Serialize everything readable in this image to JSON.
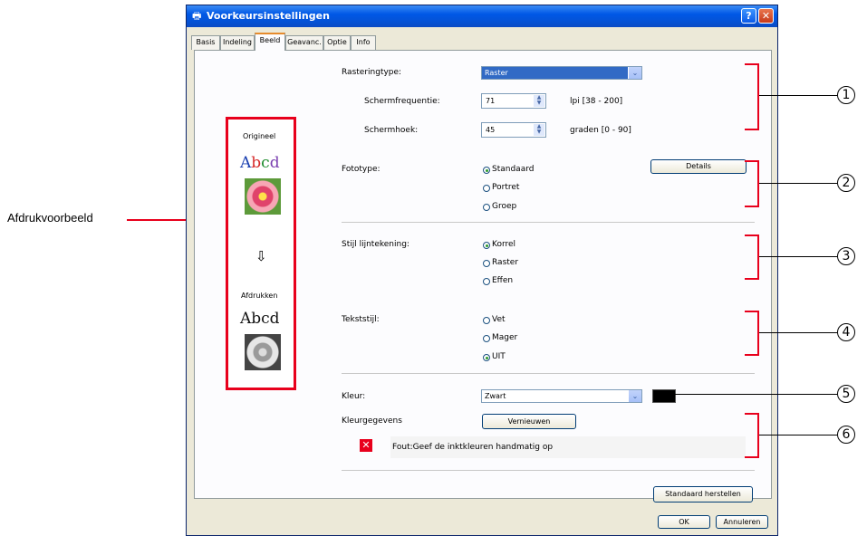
{
  "window": {
    "title": "Voorkeursinstellingen",
    "help_label": "?",
    "close_label": "✕"
  },
  "tabs": [
    {
      "label": "Basis"
    },
    {
      "label": "Indeling"
    },
    {
      "label": "Beeld",
      "active": true
    },
    {
      "label": "Geavanc."
    },
    {
      "label": "Optie"
    },
    {
      "label": "Info"
    }
  ],
  "preview": {
    "original_label": "Origineel",
    "sample_text": "Abcd",
    "arrow": "⇩",
    "print_label": "Afdrukken",
    "print_sample_text": "Abcd"
  },
  "screening": {
    "type_label": "Rasteringtype:",
    "type_value": "Raster",
    "frequency_label": "Schermfrequentie:",
    "frequency_value": "71",
    "frequency_unit": "lpi [38 - 200]",
    "angle_label": "Schermhoek:",
    "angle_value": "45",
    "angle_unit": "graden [0 - 90]"
  },
  "photo": {
    "label": "Fototype:",
    "options": [
      {
        "label": "Standaard",
        "selected": true
      },
      {
        "label": "Portret",
        "selected": false
      },
      {
        "label": "Groep",
        "selected": false
      }
    ],
    "details_button": "Details"
  },
  "line_style": {
    "label": "Stijl lijntekening:",
    "options": [
      {
        "label": "Korrel",
        "selected": true
      },
      {
        "label": "Raster",
        "selected": false
      },
      {
        "label": "Effen",
        "selected": false
      }
    ]
  },
  "text_style": {
    "label": "Tekststijl:",
    "options": [
      {
        "label": "Vet",
        "selected": false
      },
      {
        "label": "Mager",
        "selected": false
      },
      {
        "label": "UIT",
        "selected": true
      }
    ]
  },
  "color": {
    "label": "Kleur:",
    "value": "Zwart",
    "swatch": "#000000",
    "data_label": "Kleurgegevens",
    "refresh_button": "Vernieuwen",
    "error_message": "Fout:Geef de inktkleuren handmatig op"
  },
  "buttons": {
    "reset": "Standaard herstellen",
    "ok": "OK",
    "cancel": "Annuleren"
  },
  "annotations": {
    "preview_label": "Afdrukvoorbeeld",
    "callouts": [
      "1",
      "2",
      "3",
      "4",
      "5",
      "6"
    ]
  },
  "colors": {
    "accent_red": "#e8001c",
    "title_blue": "#0058e6"
  }
}
